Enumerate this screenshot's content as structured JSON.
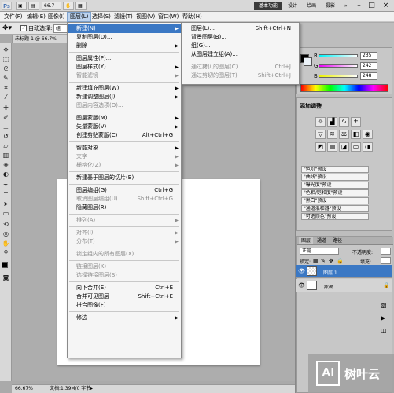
{
  "titlebar": {
    "logo": "Ps",
    "zoom_chip": "66.7",
    "workspace_active": "基本功能",
    "workspaces": [
      "设计",
      "绘画",
      "摄影"
    ],
    "overflow": "»",
    "minimize": "–",
    "maximize": "□",
    "close": "×"
  },
  "menubar": [
    "文件(F)",
    "编辑(E)",
    "图像(I)",
    "图层(L)",
    "选择(S)",
    "滤镜(T)",
    "视图(V)",
    "窗口(W)",
    "帮助(H)"
  ],
  "options": {
    "auto_select_label": "自动选择:",
    "auto_select_value": "组"
  },
  "document": {
    "tab_label": "未标题-1 @ 66.7%"
  },
  "status": {
    "zoom": "66.67%",
    "doc_info": "文档:1.39M/0 字节"
  },
  "layer_menu": {
    "items": [
      {
        "label": "新建(N)",
        "shortcut": "",
        "sub": true,
        "disabled": false,
        "hl": true
      },
      {
        "label": "复制图层(D)...",
        "shortcut": "",
        "sub": false,
        "disabled": false
      },
      {
        "label": "删除",
        "shortcut": "",
        "sub": true,
        "disabled": false
      },
      {
        "sep": true
      },
      {
        "label": "图层属性(P)...",
        "shortcut": "",
        "sub": false,
        "disabled": false
      },
      {
        "label": "图层样式(Y)",
        "shortcut": "",
        "sub": true,
        "disabled": false
      },
      {
        "label": "智能滤镜",
        "shortcut": "",
        "sub": true,
        "disabled": true
      },
      {
        "sep": true
      },
      {
        "label": "新建填充图层(W)",
        "shortcut": "",
        "sub": true,
        "disabled": false
      },
      {
        "label": "新建调整图层(J)",
        "shortcut": "",
        "sub": true,
        "disabled": false
      },
      {
        "label": "图层内容选项(O)...",
        "shortcut": "",
        "sub": false,
        "disabled": true
      },
      {
        "sep": true
      },
      {
        "label": "图层蒙版(M)",
        "shortcut": "",
        "sub": true,
        "disabled": false
      },
      {
        "label": "矢量蒙版(V)",
        "shortcut": "",
        "sub": true,
        "disabled": false
      },
      {
        "label": "创建剪贴蒙版(C)",
        "shortcut": "Alt+Ctrl+G",
        "sub": false,
        "disabled": false
      },
      {
        "sep": true
      },
      {
        "label": "智能对象",
        "shortcut": "",
        "sub": true,
        "disabled": false
      },
      {
        "label": "文字",
        "shortcut": "",
        "sub": true,
        "disabled": true
      },
      {
        "label": "栅格化(Z)",
        "shortcut": "",
        "sub": true,
        "disabled": true
      },
      {
        "sep": true
      },
      {
        "label": "新建基于图层的切片(B)",
        "shortcut": "",
        "sub": false,
        "disabled": false
      },
      {
        "sep": true
      },
      {
        "label": "图层编组(G)",
        "shortcut": "Ctrl+G",
        "sub": false,
        "disabled": false
      },
      {
        "label": "取消图层编组(U)",
        "shortcut": "Shift+Ctrl+G",
        "sub": false,
        "disabled": true
      },
      {
        "label": "隐藏图层(R)",
        "shortcut": "",
        "sub": false,
        "disabled": false
      },
      {
        "sep": true
      },
      {
        "label": "排列(A)",
        "shortcut": "",
        "sub": true,
        "disabled": true
      },
      {
        "sep": true
      },
      {
        "label": "对齐(I)",
        "shortcut": "",
        "sub": true,
        "disabled": true
      },
      {
        "label": "分布(T)",
        "shortcut": "",
        "sub": true,
        "disabled": true
      },
      {
        "sep": true
      },
      {
        "label": "锁定组内的所有图层(X)...",
        "shortcut": "",
        "sub": false,
        "disabled": true
      },
      {
        "sep": true
      },
      {
        "label": "链接图层(K)",
        "shortcut": "",
        "sub": false,
        "disabled": true
      },
      {
        "label": "选择链接图层(S)",
        "shortcut": "",
        "sub": false,
        "disabled": true
      },
      {
        "sep": true
      },
      {
        "label": "向下合并(E)",
        "shortcut": "Ctrl+E",
        "sub": false,
        "disabled": false
      },
      {
        "label": "合并可见图层",
        "shortcut": "Shift+Ctrl+E",
        "sub": false,
        "disabled": false
      },
      {
        "label": "拼合图像(F)",
        "shortcut": "",
        "sub": false,
        "disabled": false
      },
      {
        "sep": true
      },
      {
        "label": "修边",
        "shortcut": "",
        "sub": true,
        "disabled": false
      }
    ]
  },
  "new_submenu": {
    "items": [
      {
        "label": "图层(L)...",
        "shortcut": "Shift+Ctrl+N",
        "disabled": false
      },
      {
        "label": "背景图层(B)...",
        "shortcut": "",
        "disabled": false
      },
      {
        "label": "组(G)...",
        "shortcut": "",
        "disabled": false
      },
      {
        "label": "从图层建立组(A)...",
        "shortcut": "",
        "disabled": false
      },
      {
        "sep": true
      },
      {
        "label": "通过拷贝的图层(C)",
        "shortcut": "Ctrl+J",
        "disabled": true
      },
      {
        "label": "通过剪切的图层(T)",
        "shortcut": "Shift+Ctrl+J",
        "disabled": true
      }
    ]
  },
  "color_panel": {
    "r_label": "R",
    "g_label": "G",
    "b_label": "B",
    "r": "235",
    "g": "242",
    "b": "248"
  },
  "adjust_panel": {
    "title": "添加调整",
    "presets": [
      "\"色阶\"预设",
      "\"曲线\"预设",
      "\"曝光度\"预设",
      "\"色相/饱和度\"预设",
      "\"黑白\"预设",
      "\"通道混和器\"预设",
      "\"可选颜色\"预设"
    ]
  },
  "layers_panel": {
    "tabs": [
      "图层",
      "通道",
      "路径"
    ],
    "blend_mode": "正常",
    "opacity_label": "不透明度:",
    "lock_label": "锁定:",
    "fill_label": "填充:",
    "layers": [
      {
        "name": "图层 1",
        "selected": true
      },
      {
        "name": "背景",
        "selected": false
      }
    ]
  },
  "watermark": {
    "logo": "AI",
    "text": "树叶云"
  },
  "colors": {
    "menu_highlight": "#3b78c4",
    "selected_layer": "#3b78c4"
  }
}
